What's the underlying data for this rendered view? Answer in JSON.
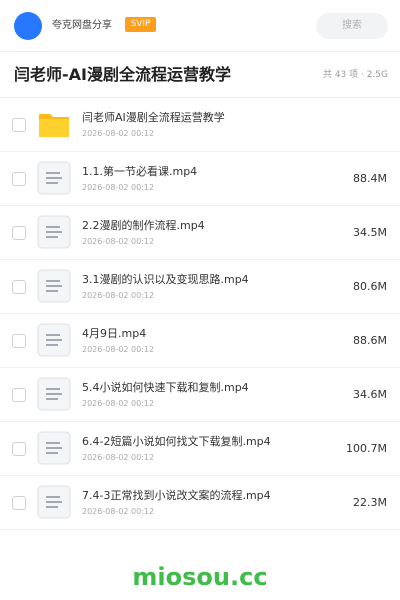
{
  "header": {
    "username": "夸克网盘分享",
    "badge": "SVIP",
    "search_placeholder": "搜索",
    "colors": {
      "avatar": "#2878ff",
      "badge": "#ff9d1c"
    }
  },
  "folder": {
    "title": "闫老师-AI漫剧全流程运营教学",
    "meta": "共 43 项 · 2.5G"
  },
  "files": [
    {
      "type": "folder",
      "icon": "folder-icon",
      "name": "闫老师AI漫剧全流程运营教学",
      "date": "2026-08-02 00:12",
      "size": ""
    },
    {
      "type": "file",
      "icon": "file-icon",
      "name": "1.1.第一节必看课.mp4",
      "date": "2026-08-02 00:12",
      "size": "88.4M"
    },
    {
      "type": "file",
      "icon": "file-icon",
      "name": "2.2漫剧的制作流程.mp4",
      "date": "2026-08-02 00:12",
      "size": "34.5M"
    },
    {
      "type": "file",
      "icon": "file-icon",
      "name": "3.1漫剧的认识以及变现思路.mp4",
      "date": "2026-08-02 00:12",
      "size": "80.6M"
    },
    {
      "type": "file",
      "icon": "file-icon",
      "name": "4月9日.mp4",
      "date": "2026-08-02 00:12",
      "size": "88.6M"
    },
    {
      "type": "file",
      "icon": "file-icon",
      "name": "5.4小说如何快速下载和复制.mp4",
      "date": "2026-08-02 00:12",
      "size": "34.6M"
    },
    {
      "type": "file",
      "icon": "file-icon",
      "name": "6.4-2短篇小说如何找文下载复制.mp4",
      "date": "2026-08-02 00:12",
      "size": "100.7M"
    },
    {
      "type": "file",
      "icon": "file-icon",
      "name": "7.4-3正常找到小说改文案的流程.mp4",
      "date": "2026-08-02 00:12",
      "size": "22.3M"
    }
  ],
  "watermark": "miosou.cc"
}
